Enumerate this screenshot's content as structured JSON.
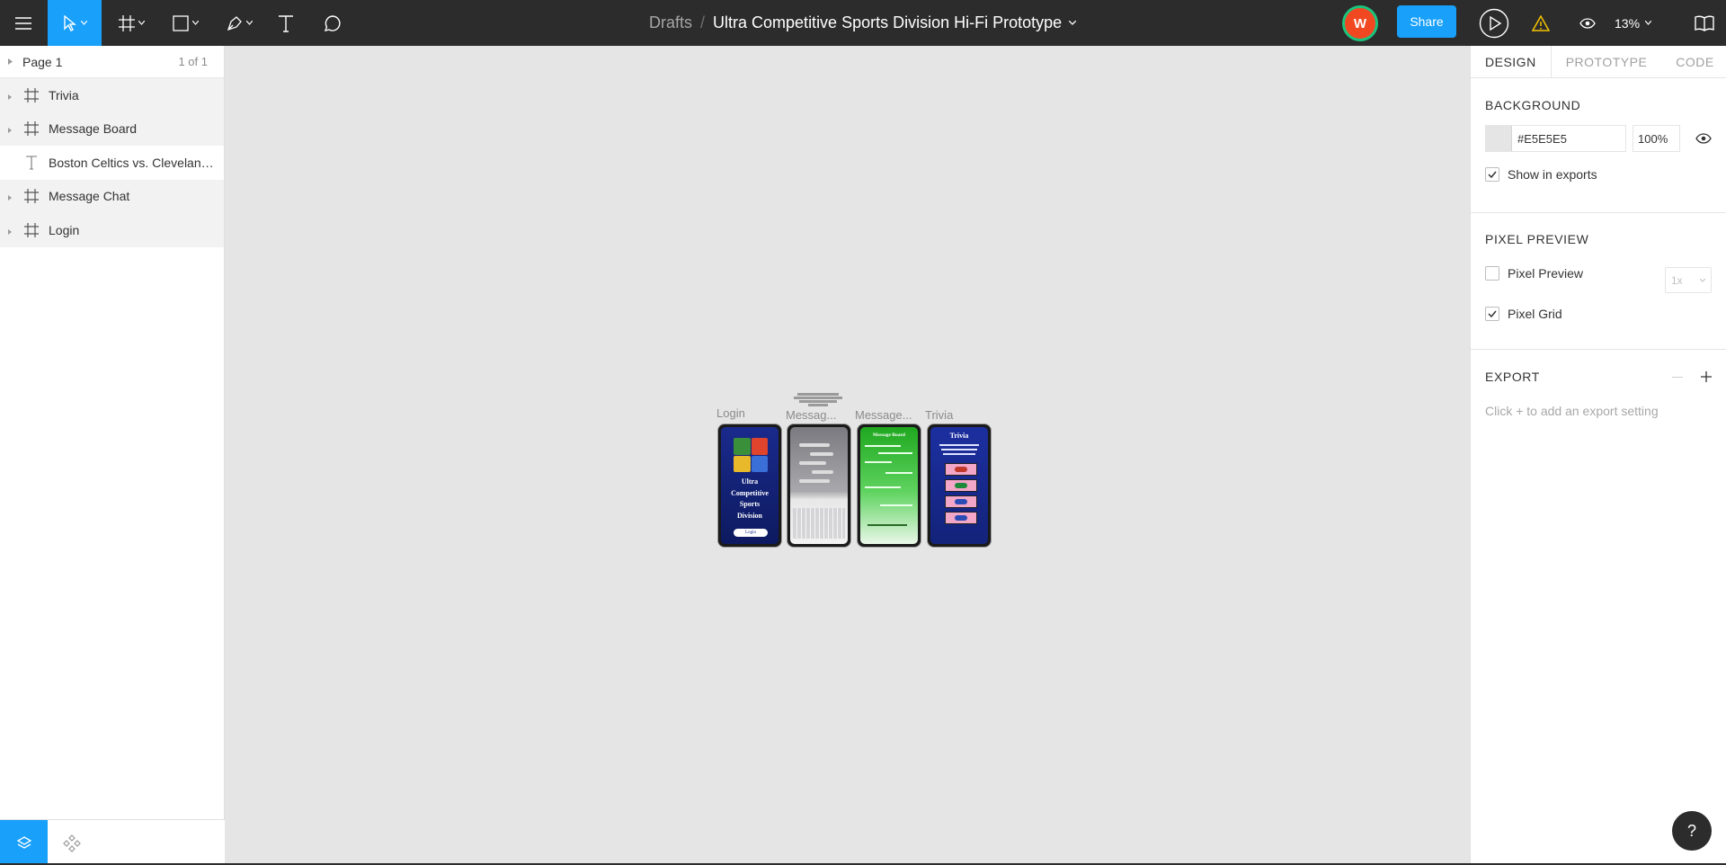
{
  "toolbar": {
    "breadcrumb_parent": "Drafts",
    "breadcrumb_sep": "/",
    "file_name": "Ultra Competitive Sports Division Hi-Fi Prototype",
    "avatar_initial": "W",
    "share_label": "Share",
    "zoom": "13%"
  },
  "pages": {
    "current": "Page 1",
    "count": "1 of 1"
  },
  "layers": [
    {
      "name": "Trivia",
      "kind": "frame"
    },
    {
      "name": "Message Board",
      "kind": "frame"
    },
    {
      "name": "Boston Celtics vs. Cleveland ...",
      "kind": "text"
    },
    {
      "name": "Message Chat",
      "kind": "frame"
    },
    {
      "name": "Login",
      "kind": "frame"
    }
  ],
  "canvas": {
    "frames": [
      {
        "label": "Login"
      },
      {
        "label": "Messag..."
      },
      {
        "label": "Message..."
      },
      {
        "label": "Trivia"
      }
    ],
    "login_screen": {
      "title_lines": [
        "Ultra",
        "Competitive",
        "Sports",
        "Division"
      ],
      "button": "Login"
    },
    "board_screen": {
      "title": "Message Board"
    },
    "trivia_screen": {
      "title": "Trivia"
    }
  },
  "right_panel": {
    "tabs": [
      "DESIGN",
      "PROTOTYPE",
      "CODE"
    ],
    "background": {
      "heading": "BACKGROUND",
      "hex": "#E5E5E5",
      "opacity": "100%",
      "show_in_exports": "Show in exports",
      "show_in_exports_checked": true
    },
    "pixel_preview": {
      "heading": "PIXEL PREVIEW",
      "preview_label": "Pixel Preview",
      "preview_checked": false,
      "scale": "1x",
      "grid_label": "Pixel Grid",
      "grid_checked": true
    },
    "export": {
      "heading": "EXPORT",
      "hint": "Click + to add an export setting"
    }
  },
  "help_label": "?",
  "colors": {
    "toolbar_bg": "#2c2c2c",
    "accent": "#18a0fb",
    "canvas_bg": "#E5E5E5",
    "avatar_bg": "#f24822",
    "avatar_ring": "#1bc47d"
  }
}
